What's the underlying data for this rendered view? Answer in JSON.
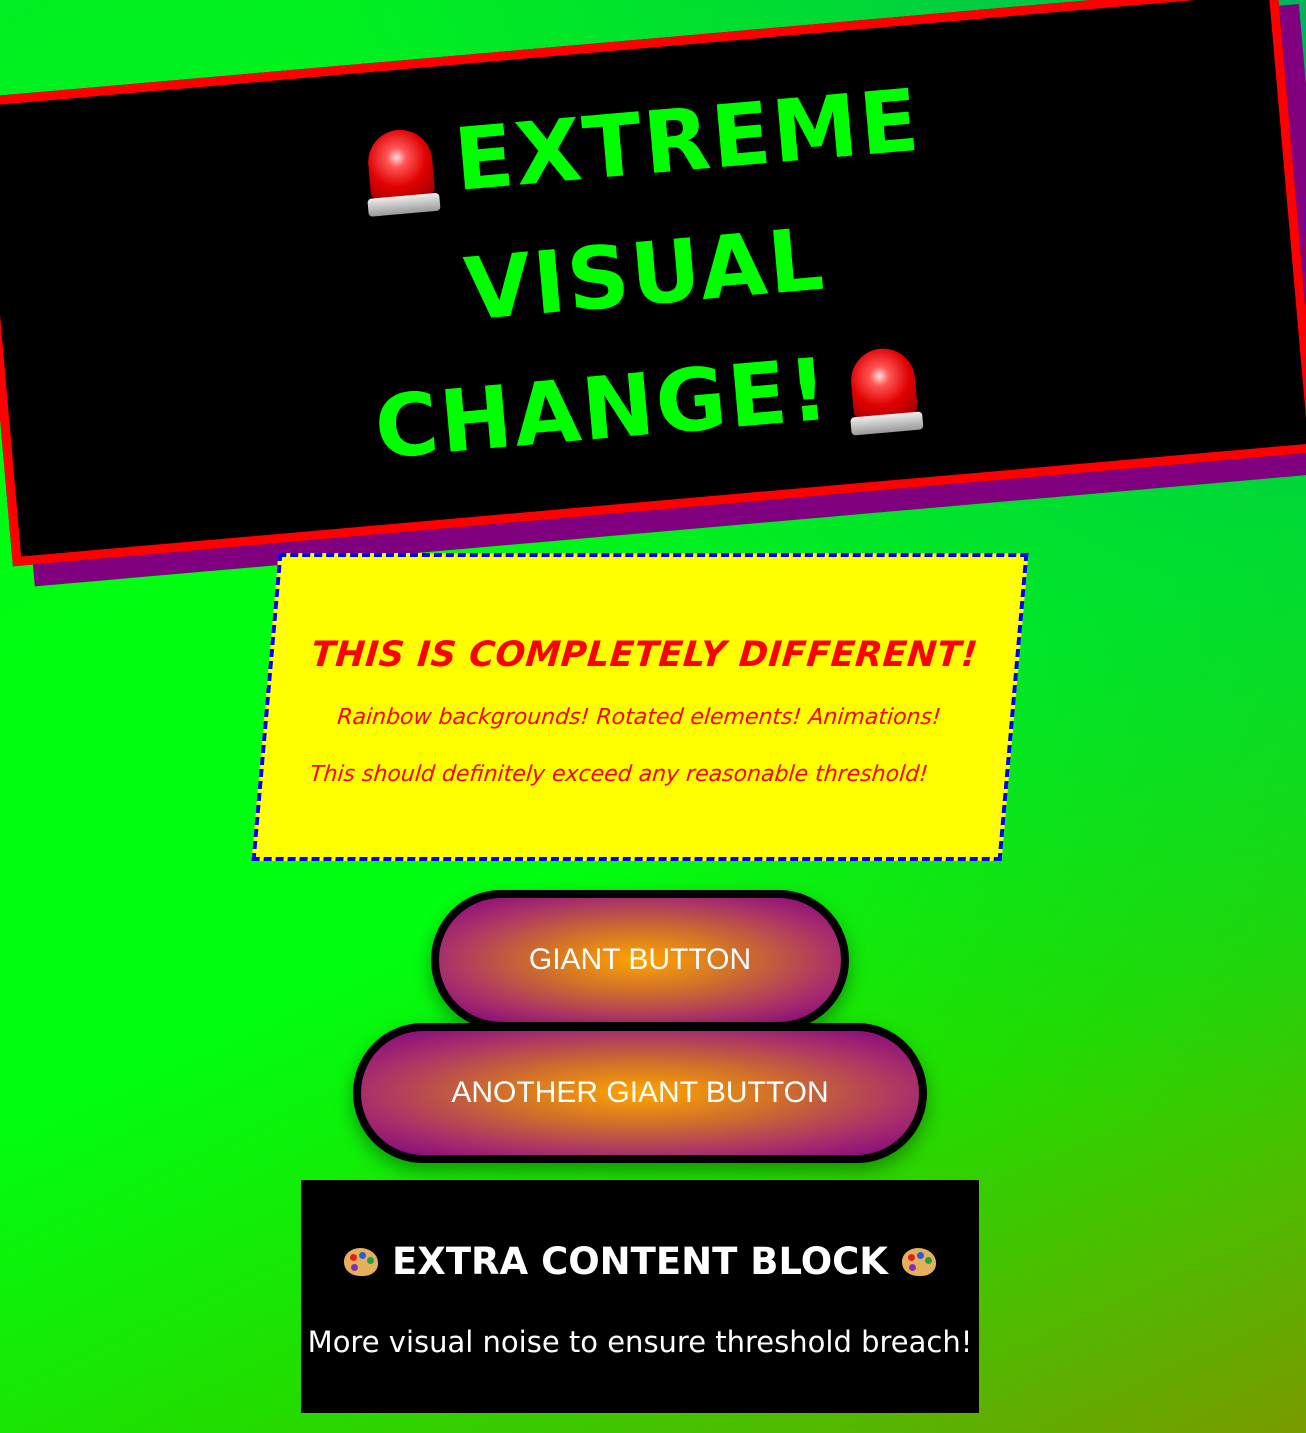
{
  "header": {
    "title_line1": "EXTREME VISUAL",
    "title_line2": "CHANGE!",
    "left_icon": "police-siren-icon",
    "right_icon": "police-siren-icon"
  },
  "card": {
    "heading": "THIS IS COMPLETELY DIFFERENT!",
    "line1": "Rainbow backgrounds! Rotated elements! Animations!",
    "line2": "This should definitely exceed any reasonable threshold!"
  },
  "buttons": {
    "giant": "GIANT BUTTON",
    "another_giant": "ANOTHER GIANT BUTTON"
  },
  "extra": {
    "title": "EXTRA CONTENT BLOCK",
    "icon": "artist-palette-icon",
    "text": "More visual noise to ensure threshold breach!"
  },
  "colors": {
    "background": "#00ff00",
    "banner_bg": "#000000",
    "banner_border": "#ff0000",
    "banner_shadow": "#800080",
    "banner_text": "#00ff00",
    "card_bg": "#ffff00",
    "card_border": "#0000ff",
    "card_text": "#ff0000",
    "button_center": "#ffa500",
    "button_edge": "#800080",
    "button_text": "#ffffff",
    "extra_bg": "#000000",
    "extra_text": "#ffffff"
  }
}
